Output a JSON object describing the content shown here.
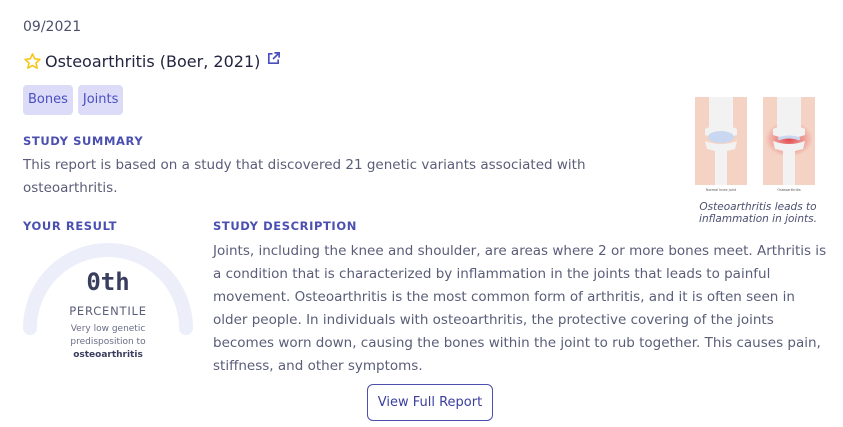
{
  "date": "09/2021",
  "title": "Osteoarthritis (Boer, 2021)",
  "tags": [
    "Bones",
    "Joints"
  ],
  "summary": {
    "label": "STUDY SUMMARY",
    "text": "This report is based on a study that discovered 21 genetic variants associated with osteoarthritis."
  },
  "result": {
    "label": "YOUR RESULT",
    "value": "0th",
    "unit": "PERCENTILE",
    "note_prefix": "Very low genetic predisposition to",
    "note_trait": "osteoarthritis",
    "percentile": 0
  },
  "description": {
    "label": "STUDY DESCRIPTION",
    "text": "Joints, including the knee and shoulder, are areas where 2 or more bones meet. Arthritis is a condition that is characterized by inflammation in the joints that leads to painful movement. Osteoarthritis is the most common form of arthritis, and it is often seen in older people. In individuals with osteoarthritis, the protective covering of the joints becomes worn down, causing the bones within the joint to rub together. This causes pain, stiffness, and other symptoms."
  },
  "illustration": {
    "label_left": "Normal knee joint",
    "label_right": "Osteoarthritis",
    "caption": "Osteoarthritis leads to inflammation in joints."
  },
  "button": {
    "label": "View Full Report"
  },
  "colors": {
    "accent": "#4a4fb0",
    "tag_bg": "#dcdcf8",
    "gauge_track": "#eceefa",
    "star": "#f5c518",
    "inflammation": "#e0303a"
  },
  "icons": {
    "favorite": "star-outline-icon",
    "external": "external-link-icon"
  }
}
